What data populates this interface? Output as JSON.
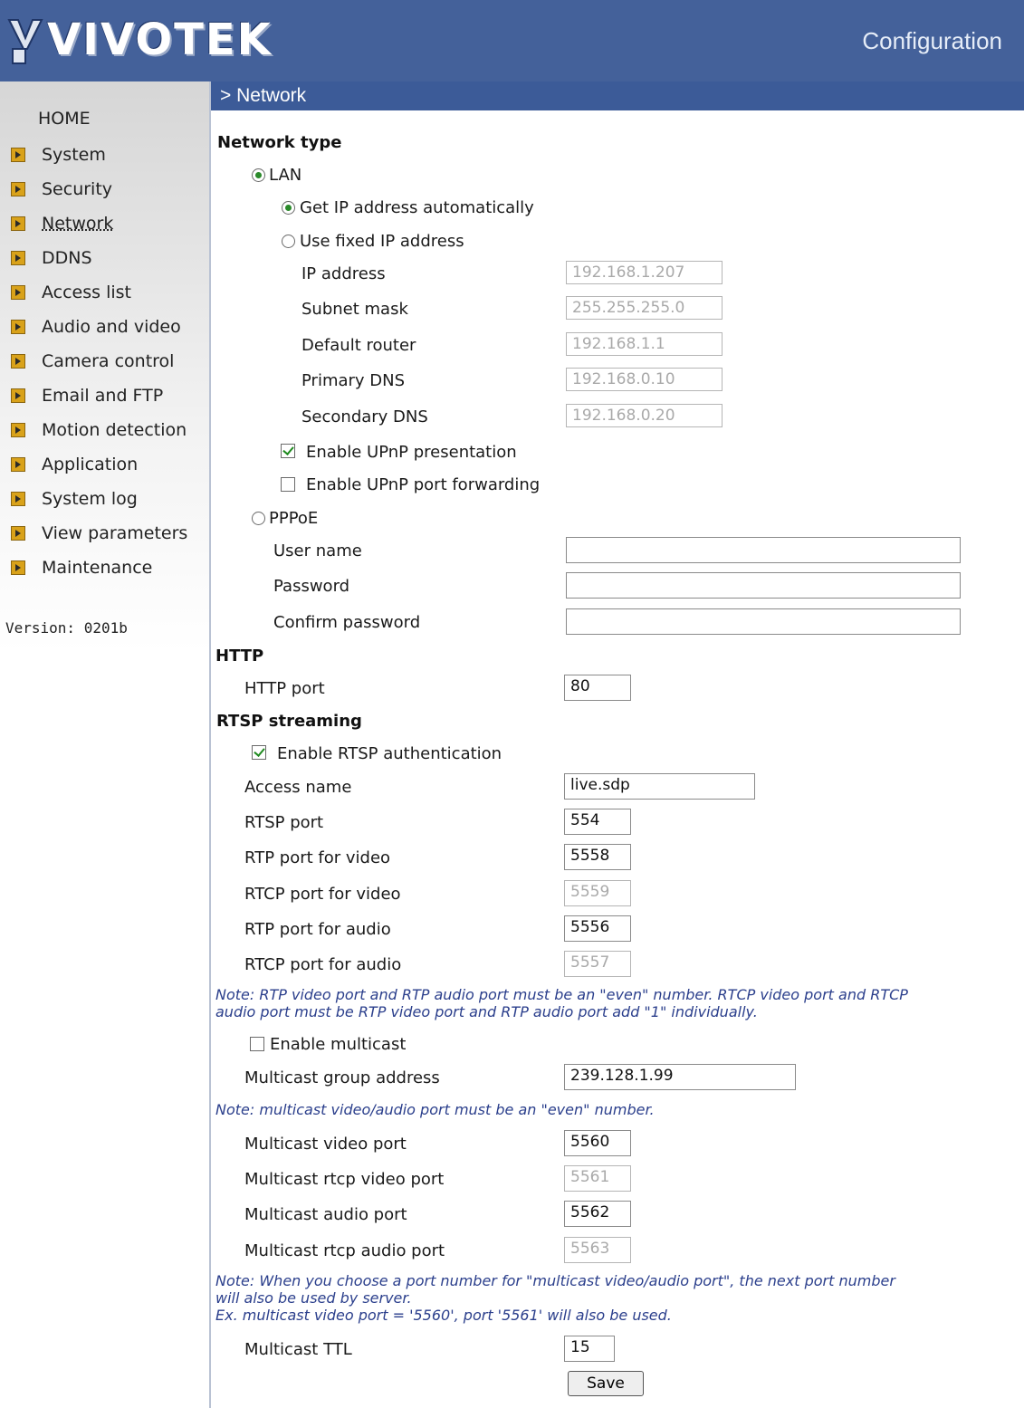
{
  "header": {
    "brand": "VIVOTEK",
    "section_title": "Configuration"
  },
  "breadcrumb": "> Network",
  "sidebar": {
    "home": "HOME",
    "items": [
      {
        "label": "System"
      },
      {
        "label": "Security"
      },
      {
        "label": "Network"
      },
      {
        "label": "DDNS"
      },
      {
        "label": "Access list"
      },
      {
        "label": "Audio and video"
      },
      {
        "label": "Camera control"
      },
      {
        "label": "Email and FTP"
      },
      {
        "label": "Motion detection"
      },
      {
        "label": "Application"
      },
      {
        "label": "System log"
      },
      {
        "label": "View parameters"
      },
      {
        "label": "Maintenance"
      }
    ],
    "version": "Version: 0201b"
  },
  "network": {
    "title": "Network type",
    "lan_label": "LAN",
    "lan_selected": true,
    "auto_ip_label": "Get IP address automatically",
    "auto_ip_selected": true,
    "fixed_ip_label": "Use fixed IP address",
    "fixed_ip_selected": false,
    "ip_label": "IP address",
    "ip_value": "192.168.1.207",
    "subnet_label": "Subnet mask",
    "subnet_value": "255.255.255.0",
    "router_label": "Default router",
    "router_value": "192.168.1.1",
    "dns1_label": "Primary DNS",
    "dns1_value": "192.168.0.10",
    "dns2_label": "Secondary DNS",
    "dns2_value": "192.168.0.20",
    "upnp_presentation_label": "Enable UPnP presentation",
    "upnp_presentation_checked": true,
    "upnp_forwarding_label": "Enable UPnP port forwarding",
    "upnp_forwarding_checked": false,
    "pppoe_label": "PPPoE",
    "pppoe_selected": false,
    "username_label": "User name",
    "username_value": "",
    "password_label": "Password",
    "password_value": "",
    "confirm_label": "Confirm password",
    "confirm_value": ""
  },
  "http": {
    "title": "HTTP",
    "port_label": "HTTP port",
    "port_value": "80"
  },
  "rtsp": {
    "title": "RTSP streaming",
    "auth_label": "Enable RTSP authentication",
    "auth_checked": true,
    "access_name_label": "Access name",
    "access_name_value": "live.sdp",
    "rtsp_port_label": "RTSP port",
    "rtsp_port_value": "554",
    "rtp_video_label": "RTP port for video",
    "rtp_video_value": "5558",
    "rtcp_video_label": "RTCP port for video",
    "rtcp_video_value": "5559",
    "rtp_audio_label": "RTP port for audio",
    "rtp_audio_value": "5556",
    "rtcp_audio_label": "RTCP port for audio",
    "rtcp_audio_value": "5557",
    "note1_line1": "Note: RTP video port and RTP audio port must be an \"even\" number. RTCP video port and RTCP",
    "note1_line2": "audio port must be RTP video port and RTP audio port add \"1\" individually.",
    "multicast_label": "Enable multicast",
    "multicast_checked": false,
    "mc_group_label": "Multicast group address",
    "mc_group_value": "239.128.1.99",
    "note2": "Note: multicast video/audio port must be an \"even\" number.",
    "mc_video_label": "Multicast video port",
    "mc_video_value": "5560",
    "mc_rtcp_video_label": "Multicast rtcp video port",
    "mc_rtcp_video_value": "5561",
    "mc_audio_label": "Multicast audio port",
    "mc_audio_value": "5562",
    "mc_rtcp_audio_label": "Multicast rtcp audio port",
    "mc_rtcp_audio_value": "5563",
    "note3_line1": "Note: When you choose a port number for \"multicast video/audio port\", the next port number",
    "note3_line2": "will also be used by server.",
    "note3_line3": "Ex. multicast video port = '5560', port '5561' will also be used.",
    "ttl_label": "Multicast TTL",
    "ttl_value": "15"
  },
  "save_label": "Save",
  "colors": {
    "header_bg": "#44619a",
    "crumb_bg": "#3c5b98",
    "note_text": "#2b3f8c"
  }
}
